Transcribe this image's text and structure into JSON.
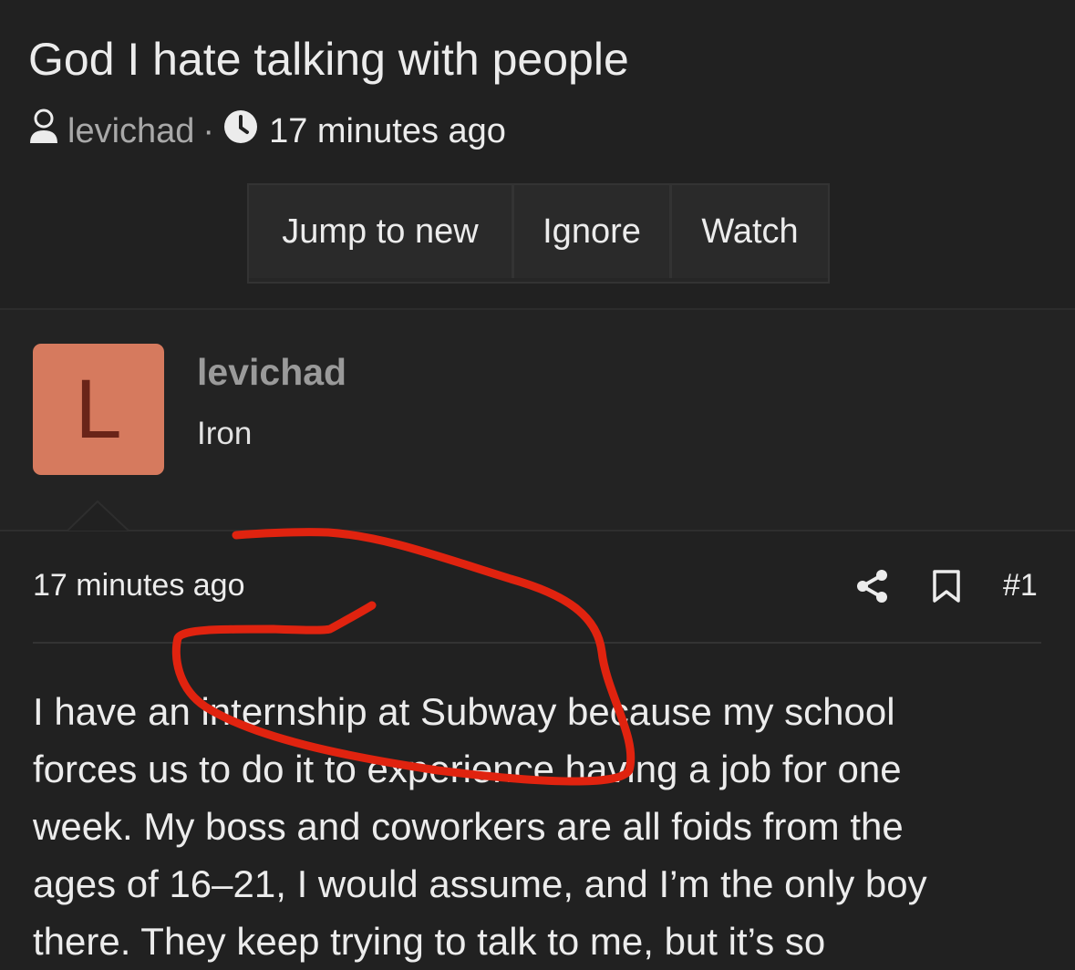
{
  "thread": {
    "title": "God I hate talking with people",
    "author": "levichad",
    "separator": "·",
    "time": "17 minutes ago"
  },
  "actions": {
    "jump_to_new": "Jump to new",
    "ignore": "Ignore",
    "watch": "Watch"
  },
  "post": {
    "avatar_letter": "L",
    "avatar_color": "#d67a5e",
    "username": "levichad",
    "user_title": "Iron",
    "time": "17 minutes ago",
    "number": "#1",
    "lines": [
      "I have an internship at Subway because my school",
      "forces us to do it to experience having a job for one",
      "week. My boss and coworkers are all foids from the",
      "ages of 16–21, I would assume, and I’m the only boy",
      "there. They keep trying to talk to me, but it’s so"
    ]
  },
  "annotation_color": "#e0230f"
}
